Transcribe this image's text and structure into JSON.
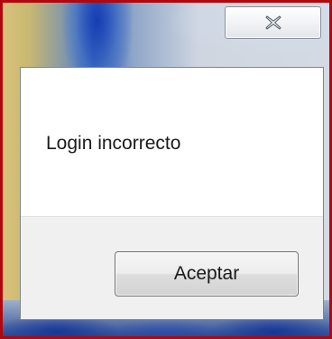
{
  "window": {
    "close_icon": "close-icon"
  },
  "dialog": {
    "message": "Login incorrecto",
    "ok_label": "Aceptar"
  },
  "colors": {
    "frame_border": "#b4060d",
    "dialog_background": "#ffffff",
    "footer_background": "#f0f0f0"
  }
}
